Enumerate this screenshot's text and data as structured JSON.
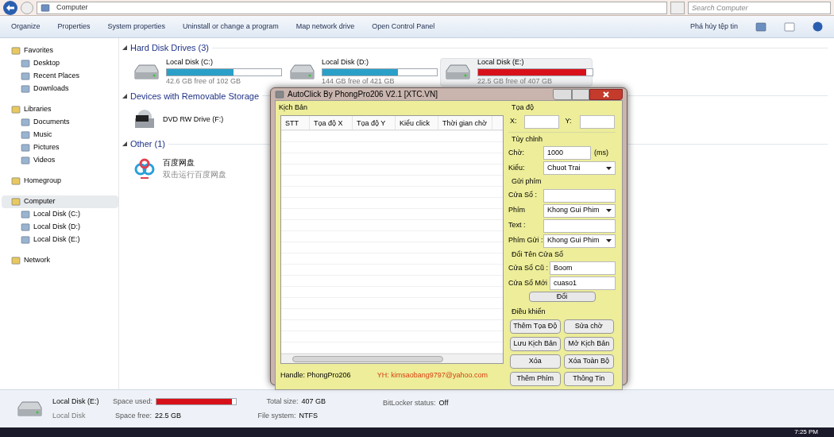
{
  "address_bar": {
    "path": [
      "Computer"
    ],
    "search_placeholder": "Search Computer"
  },
  "toolbar": {
    "items": [
      "Organize",
      "Properties",
      "System properties",
      "Uninstall or change a program",
      "Map network drive",
      "Open Control Panel"
    ],
    "right_item": "Phá hủy tệp tin"
  },
  "sidebar": {
    "groups": [
      {
        "label": "Favorites",
        "selected": false,
        "children": [
          {
            "label": "Desktop",
            "selected": false
          },
          {
            "label": "Recent Places",
            "selected": false
          },
          {
            "label": "Downloads",
            "selected": false
          }
        ]
      },
      {
        "label": "Libraries",
        "selected": false,
        "children": [
          {
            "label": "Documents",
            "selected": false
          },
          {
            "label": "Music",
            "selected": false
          },
          {
            "label": "Pictures",
            "selected": false
          },
          {
            "label": "Videos",
            "selected": false
          }
        ]
      },
      {
        "label": "Homegroup",
        "selected": false
      },
      {
        "label": "Computer",
        "selected": true,
        "children": [
          {
            "label": "Local Disk (C:)",
            "selected": false
          },
          {
            "label": "Local Disk (D:)",
            "selected": false
          },
          {
            "label": "Local Disk (E:)",
            "selected": false
          }
        ]
      },
      {
        "label": "Network",
        "selected": false
      }
    ]
  },
  "sections": [
    {
      "title": "Hard Disk Drives (3)",
      "kind": "drives",
      "items": [
        {
          "name": "Local Disk (C:)",
          "free": "42.6 GB free of 102 GB",
          "level": 0.58,
          "low_space": false,
          "selected": false
        },
        {
          "name": "Local Disk (D:)",
          "free": "144 GB free of 421 GB",
          "level": 0.66,
          "low_space": false,
          "selected": false
        },
        {
          "name": "Local Disk (E:)",
          "free": "22.5 GB free of 407 GB",
          "level": 0.945,
          "low_space": true,
          "selected": true
        }
      ]
    },
    {
      "title": "Devices with Removable Storage",
      "kind": "dvd",
      "items": [
        {
          "name": "DVD RW Drive (F:)",
          "selected": false
        }
      ]
    },
    {
      "title": "Other (1)",
      "kind": "app",
      "items": [
        {
          "name": "百度网盘",
          "subtitle": "双击运行百度网盘",
          "selected": false
        }
      ]
    }
  ],
  "details": {
    "name": "Local Disk (E:)",
    "type": "Local Disk",
    "used_label": "Space used:",
    "level": 0.945,
    "free_label": "Space free:",
    "free_value": "22.5 GB",
    "total_label": "Total size:",
    "total_value": "407 GB",
    "fs_label": "File system:",
    "fs_value": "NTFS",
    "bitlocker_label": "BitLocker status:",
    "bitlocker_value": "Off"
  },
  "taskbar": {
    "clock": "7:25 PM"
  },
  "autoclick": {
    "title": "AutoClick By PhongPro206 V2.1 [XTC.VN]",
    "script_group": "Kịch Bản",
    "columns": [
      "STT",
      "Tọa độ X",
      "Tọa độ Y",
      "Kiểu click",
      "Thời gian chờ"
    ],
    "handle": "Handle: PhongPro206",
    "contact": "YH: kimsaobang9797@yahoo.com",
    "coord_group": {
      "title": "Tọa độ",
      "fields": [
        "X:",
        "Y:"
      ]
    },
    "groups": [
      {
        "title": "Tùy chỉnh",
        "rows": [
          {
            "label": "Chờ:",
            "kind": "input",
            "value": "1000",
            "unit": "(ms)"
          },
          {
            "label": "Kiểu:",
            "kind": "select",
            "value": "Chuot Trai"
          }
        ]
      },
      {
        "title": "Gửi phím",
        "rows": [
          {
            "label": "Cửa Sổ :",
            "kind": "input"
          },
          {
            "label": "Phím",
            "kind": "select",
            "value": "Khong Gui Phim"
          },
          {
            "label": "Text :",
            "kind": "input"
          },
          {
            "label": "Phím Gửi :",
            "kind": "select",
            "value": "Khong Gui Phim"
          }
        ]
      },
      {
        "title": "Đổi Tên Cửa Sổ",
        "rows": [
          {
            "label": "Cửa Sổ Cũ :",
            "kind": "input",
            "value": "Boom"
          },
          {
            "label": "Cửa Sổ Mới",
            "kind": "input",
            "value": "cuaso1"
          }
        ],
        "button": "Đổi"
      }
    ],
    "controls": {
      "title": "Điều khiển",
      "buttons": [
        "Thêm Tọa Độ",
        "Sửa chờ",
        "Lưu Kịch Bản",
        "Mở Kịch Bản",
        "Xóa",
        "Xóa Toàn Bộ",
        "Thêm Phím",
        "Thông Tin"
      ]
    }
  }
}
